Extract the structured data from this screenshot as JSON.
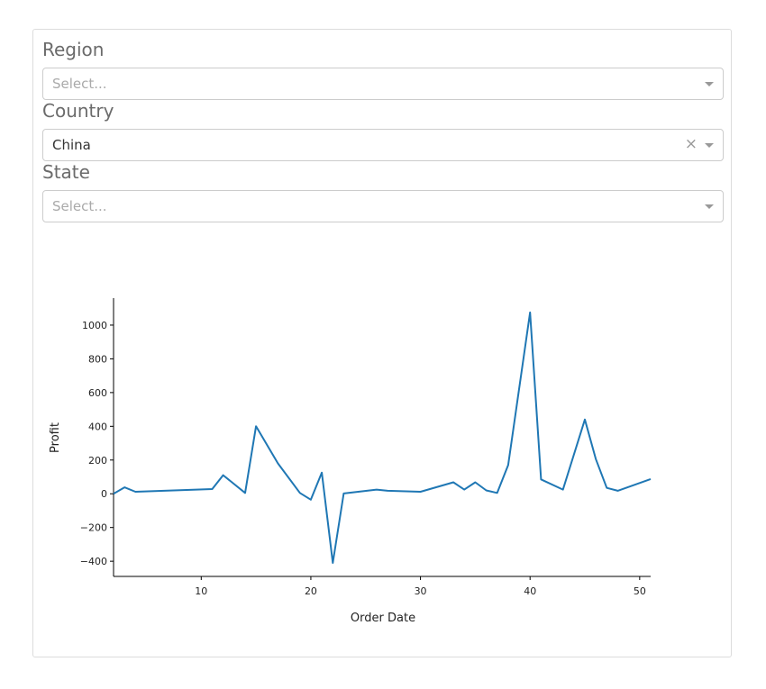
{
  "filters": {
    "region": {
      "label": "Region",
      "placeholder": "Select..."
    },
    "country": {
      "label": "Country",
      "value": "China"
    },
    "state": {
      "label": "State",
      "placeholder": "Select..."
    }
  },
  "icons": {
    "clear": "×",
    "clear_icon": "close-icon",
    "dropdown_icon": "caret-down-icon"
  },
  "colors": {
    "line": "#1f77b4",
    "axis": "#000000",
    "label_gray": "#6b6b6b"
  },
  "chart_data": {
    "type": "line",
    "xlabel": "Order Date",
    "ylabel": "Profit",
    "xlim": [
      2,
      51
    ],
    "ylim": [
      -490,
      1160
    ],
    "xticks": [
      10,
      20,
      30,
      40,
      50
    ],
    "yticks": [
      -400,
      -200,
      0,
      200,
      400,
      600,
      800,
      1000
    ],
    "ytick_labels": [
      "−400",
      "−200",
      "0",
      "200",
      "400",
      "600",
      "800",
      "1000"
    ],
    "grid": false,
    "series": [
      {
        "x": [
          2,
          3,
          4,
          11,
          12,
          14,
          15,
          17,
          19,
          20,
          21,
          22,
          23,
          26,
          27,
          30,
          33,
          34,
          35,
          36,
          37,
          38,
          40,
          41,
          43,
          45,
          46,
          47,
          48,
          51
        ],
        "y": [
          0,
          38,
          12,
          28,
          110,
          5,
          400,
          180,
          5,
          -35,
          125,
          -410,
          2,
          25,
          18,
          12,
          68,
          25,
          68,
          20,
          5,
          170,
          1075,
          85,
          25,
          440,
          205,
          35,
          18,
          87
        ]
      }
    ]
  }
}
